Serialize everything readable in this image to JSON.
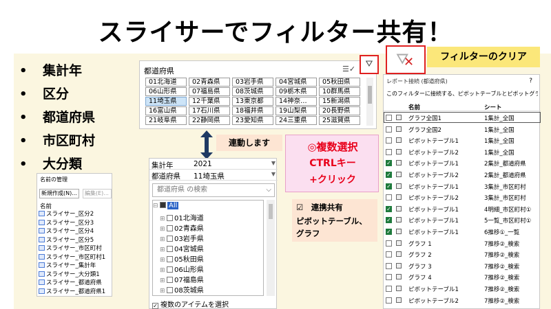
{
  "title": "スライサーでフィルター共有！",
  "bullets": [
    "集計年",
    "区分",
    "都道府県",
    "市区町村",
    "大分類"
  ],
  "bullet_glyph": "•",
  "slicer": {
    "header": "都道府県",
    "multiselect_icon": "multiselect-icon",
    "clear_filter_icon": "clear-filter-icon",
    "items": [
      [
        "01北海道",
        "02青森県",
        "03岩手県",
        "04宮城県",
        "05秋田県"
      ],
      [
        "06山形県",
        "07福島県",
        "08茨城県",
        "09栃木県",
        "10群馬県"
      ],
      [
        "11埼玉県",
        "12千葉県",
        "13東京都",
        "14神奈…",
        "15新潟県"
      ],
      [
        "16富山県",
        "17石川県",
        "18福井県",
        "19山梨県",
        "20長野県"
      ],
      [
        "21岐阜県",
        "22静岡県",
        "23愛知県",
        "24三重県",
        "25滋賀県"
      ]
    ],
    "selected": "11埼玉県"
  },
  "clear_label": "フィルターのクリア",
  "renkei_label": "連動します",
  "pivot": {
    "row1_key": "集計年",
    "row1_value": "2021",
    "row2_key": "都道府県",
    "row2_value": "11埼玉県",
    "search_placeholder": "都道府県 の検索",
    "all_label": "All",
    "tree_items": [
      "01北海道",
      "02青森県",
      "03岩手県",
      "04宮城県",
      "05秋田県",
      "06山形県",
      "07福島県",
      "08茨城県"
    ],
    "multi_label": "複数のアイテムを選択"
  },
  "names_dialog": {
    "title": "名前の管理",
    "new_button": "新規作成(N)...",
    "edit_button": "編集(E)...",
    "column_header": "名前",
    "items": [
      "スライサー_区分2",
      "スライサー_区分3",
      "スライサー_区分4",
      "スライサー_区分5",
      "スライサー_市区町村",
      "スライサー_市区町村1",
      "スライサー_集計年",
      "スライサー_大分類1",
      "スライサー_都道府県",
      "スライサー_都道府県1"
    ]
  },
  "multi_box": {
    "line1": "◎複数選択",
    "line2": "CTRLキー",
    "line3": "+クリック"
  },
  "share_box": {
    "line1": "☑　連携共有",
    "line2": "ピボットテーブル、",
    "line3": "グラフ"
  },
  "report": {
    "title": "レポート接続 (都道府県)",
    "help": "?",
    "description": "このフィルターに接続する、ピボットテーブルとピボットグラフのレポートを選択して",
    "col_name": "名前",
    "col_sheet": "シート",
    "rows": [
      {
        "name": "グラフ全国1",
        "sheet": "1集計_全国",
        "checked": false
      },
      {
        "name": "グラフ全国2",
        "sheet": "1集計_全国",
        "checked": false
      },
      {
        "name": "ピボットテーブル1",
        "sheet": "1集計_全国",
        "checked": false
      },
      {
        "name": "ピボットテーブル2",
        "sheet": "1集計_全国",
        "checked": false
      },
      {
        "name": "ピボットテーブル1",
        "sheet": "2集計_都道府県",
        "checked": true
      },
      {
        "name": "ピボットテーブル2",
        "sheet": "2集計_都道府県",
        "checked": true
      },
      {
        "name": "ピボットテーブル1",
        "sheet": "3集計_市区町村",
        "checked": true
      },
      {
        "name": "ピボットテーブル2",
        "sheet": "3集計_市区町村",
        "checked": false
      },
      {
        "name": "ピボットテーブル1",
        "sheet": "4明細_市区町村①",
        "checked": true
      },
      {
        "name": "ピボットテーブル1",
        "sheet": "5一覧_市区町村①",
        "checked": true
      },
      {
        "name": "ピボットテーブル1",
        "sheet": "6推移①_一覧",
        "checked": true
      },
      {
        "name": "グラフ 1",
        "sheet": "7推移②_検索",
        "checked": false
      },
      {
        "name": "グラフ 2",
        "sheet": "7推移②_検索",
        "checked": false
      },
      {
        "name": "グラフ 3",
        "sheet": "7推移②_検索",
        "checked": false
      },
      {
        "name": "グラフ 4",
        "sheet": "7推移②_検索",
        "checked": false
      },
      {
        "name": "ピボットテーブル1",
        "sheet": "7推移②_検索",
        "checked": false
      },
      {
        "name": "ピボットテーブル2",
        "sheet": "7推移②_検索",
        "checked": false
      }
    ],
    "highlighted_row": 0
  },
  "colors": {
    "accent_red": "#e02020",
    "check_green": "#1e7a3c",
    "slicer_selected": "#cde4f7",
    "callout_yellow": "#fbe77a",
    "callout_pink": "#fbdff0",
    "callout_peach": "#fde5d3"
  }
}
